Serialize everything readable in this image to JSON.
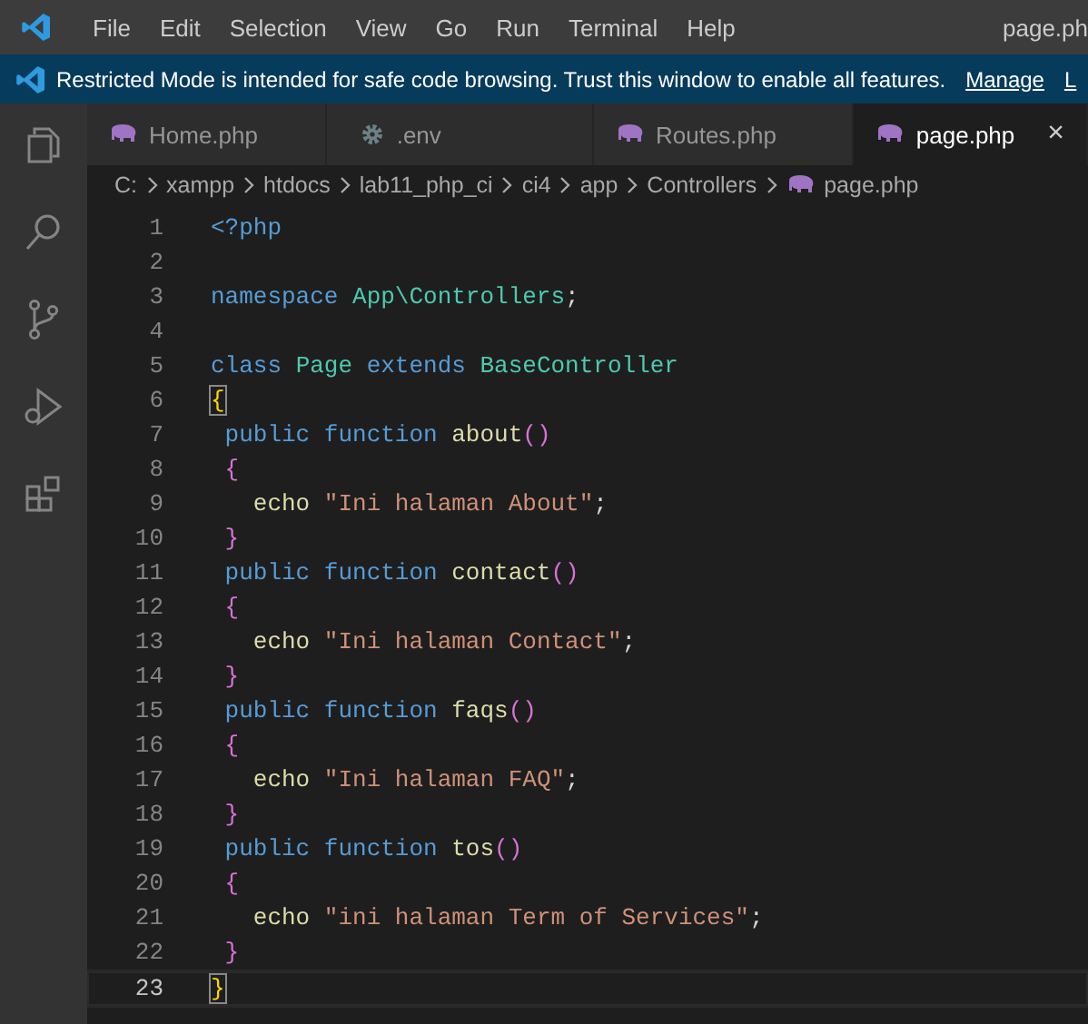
{
  "title_bar": {
    "menu": [
      "File",
      "Edit",
      "Selection",
      "View",
      "Go",
      "Run",
      "Terminal",
      "Help"
    ],
    "title": "page.ph"
  },
  "banner": {
    "text": "Restricted Mode is intended for safe code browsing. Trust this window to enable all features.",
    "links": [
      "Manage",
      "L"
    ]
  },
  "activity_bar": [
    {
      "kind": "explorer"
    },
    {
      "kind": "search"
    },
    {
      "kind": "source-control"
    },
    {
      "kind": "run-debug"
    },
    {
      "kind": "extensions"
    }
  ],
  "tabs": [
    {
      "label": "Home.php",
      "kind": "php",
      "selected": false
    },
    {
      "label": ".env",
      "kind": "config",
      "selected": false
    },
    {
      "label": "Routes.php",
      "kind": "php",
      "selected": false
    },
    {
      "label": "page.php",
      "kind": "php",
      "selected": true,
      "close": "×"
    }
  ],
  "breadcrumb": [
    "C:",
    "xampp",
    "htdocs",
    "lab11_php_ci",
    "ci4",
    "app",
    "Controllers",
    "page.php"
  ],
  "editor": {
    "lines": [
      {
        "number": "1",
        "current": false,
        "tokens": [
          {
            "kind": "keyword",
            "text": "<?php"
          }
        ]
      },
      {
        "number": "2",
        "current": false
      },
      {
        "number": "3",
        "current": false,
        "tokens": [
          {
            "kind": "keyword",
            "text": "namespace "
          },
          {
            "kind": "type",
            "text": "App\\Controllers"
          },
          {
            "kind": "plain",
            "text": ";"
          }
        ]
      },
      {
        "number": "4",
        "current": false
      },
      {
        "number": "5",
        "current": false,
        "tokens": [
          {
            "kind": "keyword",
            "text": "class "
          },
          {
            "kind": "type",
            "text": "Page "
          },
          {
            "kind": "keyword",
            "text": "extends "
          },
          {
            "kind": "type",
            "text": "BaseController"
          }
        ]
      },
      {
        "number": "6",
        "current": false,
        "tokens": [
          {
            "kind": "bracket-match",
            "text": "{"
          }
        ]
      },
      {
        "number": "7",
        "current": false,
        "tokens": [
          {
            "kind": "keyword",
            "text": " public function "
          },
          {
            "kind": "function",
            "text": "about"
          },
          {
            "kind": "bracket",
            "text": "()"
          }
        ]
      },
      {
        "number": "8",
        "current": false,
        "tokens": [
          {
            "kind": "bracket",
            "text": " {"
          }
        ]
      },
      {
        "number": "9",
        "current": false,
        "tokens": [
          {
            "kind": "function",
            "text": "   echo "
          },
          {
            "kind": "string",
            "text": "\"Ini halaman About\""
          },
          {
            "kind": "plain",
            "text": ";"
          }
        ]
      },
      {
        "number": "10",
        "current": false,
        "tokens": [
          {
            "kind": "bracket",
            "text": " }"
          }
        ]
      },
      {
        "number": "11",
        "current": false,
        "tokens": [
          {
            "kind": "keyword",
            "text": " public function "
          },
          {
            "kind": "function",
            "text": "contact"
          },
          {
            "kind": "bracket",
            "text": "()"
          }
        ]
      },
      {
        "number": "12",
        "current": false,
        "tokens": [
          {
            "kind": "bracket",
            "text": " {"
          }
        ]
      },
      {
        "number": "13",
        "current": false,
        "tokens": [
          {
            "kind": "function",
            "text": "   echo "
          },
          {
            "kind": "string",
            "text": "\"Ini halaman Contact\""
          },
          {
            "kind": "plain",
            "text": ";"
          }
        ]
      },
      {
        "number": "14",
        "current": false,
        "tokens": [
          {
            "kind": "bracket",
            "text": " }"
          }
        ]
      },
      {
        "number": "15",
        "current": false,
        "tokens": [
          {
            "kind": "keyword",
            "text": " public function "
          },
          {
            "kind": "function",
            "text": "faqs"
          },
          {
            "kind": "bracket",
            "text": "()"
          }
        ]
      },
      {
        "number": "16",
        "current": false,
        "tokens": [
          {
            "kind": "bracket",
            "text": " {"
          }
        ]
      },
      {
        "number": "17",
        "current": false,
        "tokens": [
          {
            "kind": "function",
            "text": "   echo "
          },
          {
            "kind": "string",
            "text": "\"Ini halaman FAQ\""
          },
          {
            "kind": "plain",
            "text": ";"
          }
        ]
      },
      {
        "number": "18",
        "current": false,
        "tokens": [
          {
            "kind": "bracket",
            "text": " }"
          }
        ]
      },
      {
        "number": "19",
        "current": false,
        "tokens": [
          {
            "kind": "keyword",
            "text": " public function "
          },
          {
            "kind": "function",
            "text": "tos"
          },
          {
            "kind": "bracket",
            "text": "()"
          }
        ]
      },
      {
        "number": "20",
        "current": false,
        "tokens": [
          {
            "kind": "bracket",
            "text": " {"
          }
        ]
      },
      {
        "number": "21",
        "current": false,
        "tokens": [
          {
            "kind": "function",
            "text": "   echo "
          },
          {
            "kind": "string",
            "text": "\"ini halaman Term of Services\""
          },
          {
            "kind": "plain",
            "text": ";"
          }
        ]
      },
      {
        "number": "22",
        "current": false,
        "tokens": [
          {
            "kind": "bracket",
            "text": " }"
          }
        ]
      },
      {
        "number": "23",
        "current": true,
        "tokens": [
          {
            "kind": "bracket-match",
            "text": "}"
          }
        ]
      }
    ]
  }
}
